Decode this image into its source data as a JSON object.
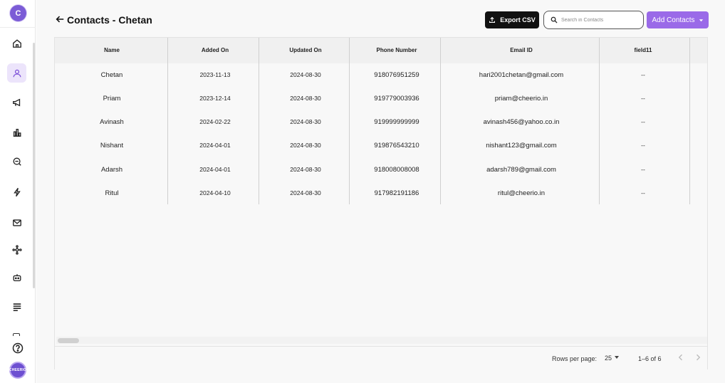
{
  "sidebar": {
    "logo_text": "C",
    "avatar_text": "CHEERIO",
    "active_index": 1
  },
  "header": {
    "title": "Contacts - Chetan",
    "export_label": "Export CSV",
    "search_placeholder": "Search in Contacts",
    "add_label": "Add Contacts"
  },
  "table": {
    "columns": [
      "Name",
      "Added On",
      "Updated On",
      "Phone Number",
      "Email ID",
      "field11"
    ],
    "rows": [
      [
        "Chetan",
        "2023-11-13",
        "2024-08-30",
        "918076951259",
        "hari2001chetan@gmail.com",
        "--"
      ],
      [
        "Priam",
        "2023-12-14",
        "2024-08-30",
        "919779003936",
        "priam@cheerio.in",
        "--"
      ],
      [
        "Avinash",
        "2024-02-22",
        "2024-08-30",
        "919999999999",
        "avinash456@yahoo.co.in",
        "--"
      ],
      [
        "Nishant",
        "2024-04-01",
        "2024-08-30",
        "919876543210",
        "nishant123@gmail.com",
        "--"
      ],
      [
        "Adarsh",
        "2024-04-01",
        "2024-08-30",
        "918008008008",
        "adarsh789@gmail.com",
        "--"
      ],
      [
        "Ritul",
        "2024-04-10",
        "2024-08-30",
        "917982191186",
        "ritul@cheerio.in",
        "--"
      ]
    ]
  },
  "pagination": {
    "rows_per_page_label": "Rows per page:",
    "rows_per_page": "25",
    "range": "1–6 of 6"
  },
  "colors": {
    "accent": "#9a6ae8",
    "active_nav_bg": "#ece4fb",
    "export_bg": "#111111"
  }
}
